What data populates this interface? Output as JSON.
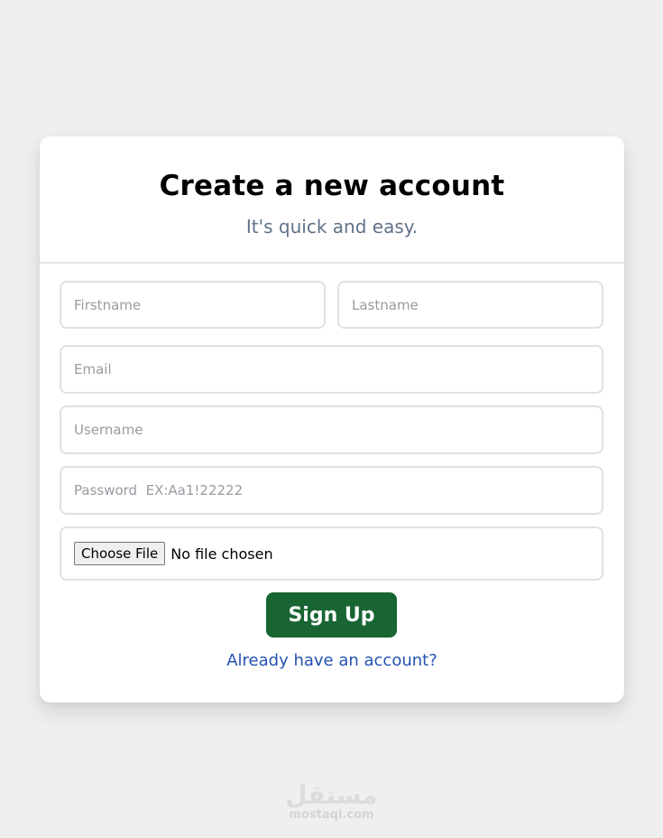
{
  "form": {
    "title": "Create a new account",
    "subtitle": "It's quick and easy.",
    "firstname_placeholder": "Firstname",
    "lastname_placeholder": "Lastname",
    "email_placeholder": "Email",
    "username_placeholder": "Username",
    "password_placeholder": "Password  EX:Aa1!22222",
    "file_button_label": "Choose File",
    "file_status": "No file chosen",
    "submit_label": "Sign Up",
    "login_link": "Already have an account?"
  },
  "watermark": {
    "logo_text": "مستقل",
    "site": "mostaqi.com"
  },
  "colors": {
    "background": "#efefef",
    "card": "#ffffff",
    "primary_button": "#186533",
    "link": "#2452b0",
    "subtitle": "#5f7287"
  }
}
